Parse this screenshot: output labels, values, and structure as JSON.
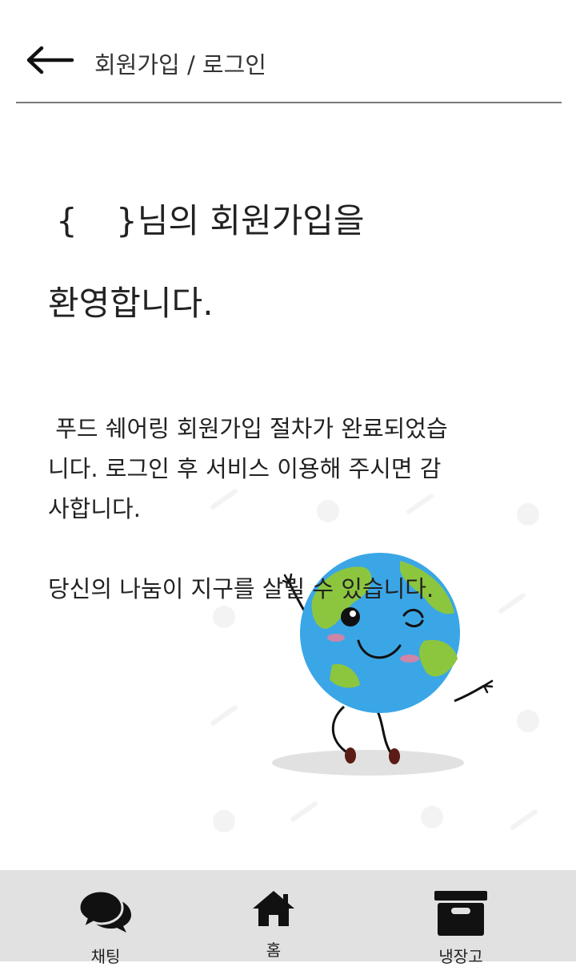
{
  "header": {
    "title": "회원가입 / 로그인",
    "back_icon": "arrow-left-icon"
  },
  "welcome": {
    "brace_open": "{",
    "line1_rest": "}님의 회원가입을",
    "line2": "환영합니다."
  },
  "message": {
    "line1": "푸드 쉐어링 회원가입 절차가 완료되었습",
    "line2": "니다.  로그인 후 서비스 이용해 주시면 감",
    "line3": "사합니다.",
    "line4": "당신의 나눔이 지구를 살릴 수 있습니다."
  },
  "illustration": {
    "icon": "earth-mascot-icon"
  },
  "tabbar": {
    "items": [
      {
        "label": "채팅",
        "icon": "chat-bubbles-icon"
      },
      {
        "label": "홈",
        "icon": "home-icon"
      },
      {
        "label": "냉장고",
        "icon": "archive-box-icon"
      }
    ]
  },
  "colors": {
    "tabbar_bg": "#e1e1e1",
    "divider": "#7a7a7a",
    "earth_blue": "#3aa6e6",
    "earth_green": "#8cc63f"
  }
}
